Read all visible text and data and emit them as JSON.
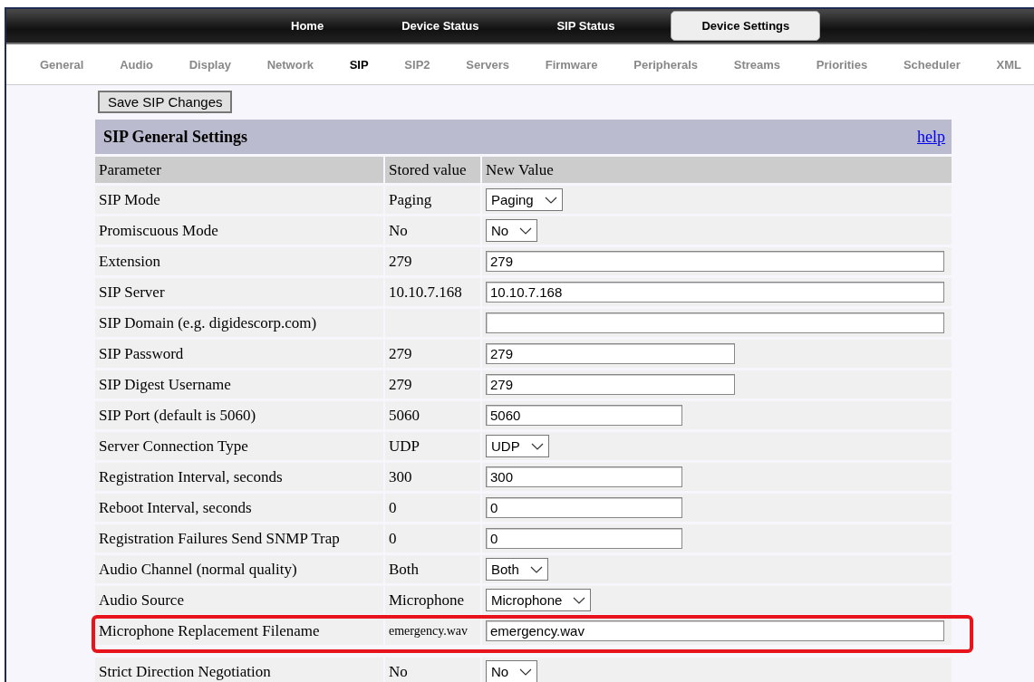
{
  "main_tabs": [
    {
      "label": "Home",
      "selected": false
    },
    {
      "label": "Device Status",
      "selected": false
    },
    {
      "label": "SIP Status",
      "selected": false
    },
    {
      "label": "Device Settings",
      "selected": true
    }
  ],
  "sub_tabs": [
    {
      "label": "General",
      "selected": false
    },
    {
      "label": "Audio",
      "selected": false
    },
    {
      "label": "Display",
      "selected": false
    },
    {
      "label": "Network",
      "selected": false
    },
    {
      "label": "SIP",
      "selected": true
    },
    {
      "label": "SIP2",
      "selected": false
    },
    {
      "label": "Servers",
      "selected": false
    },
    {
      "label": "Firmware",
      "selected": false
    },
    {
      "label": "Peripherals",
      "selected": false
    },
    {
      "label": "Streams",
      "selected": false
    },
    {
      "label": "Priorities",
      "selected": false
    },
    {
      "label": "Scheduler",
      "selected": false
    },
    {
      "label": "XML",
      "selected": false
    }
  ],
  "save_button": "Save SIP Changes",
  "section": {
    "title": "SIP General Settings",
    "help_link": "help"
  },
  "columns": [
    "Parameter",
    "Stored value",
    "New Value"
  ],
  "rows": [
    {
      "parameter": "SIP Mode",
      "stored": "Paging",
      "new_value": "Paging",
      "kind": "select",
      "highlighted": false
    },
    {
      "parameter": "Promiscuous Mode",
      "stored": "No",
      "new_value": "No",
      "kind": "select",
      "highlighted": false
    },
    {
      "parameter": "Extension",
      "stored": "279",
      "new_value": "279",
      "kind": "input-wide",
      "highlighted": false
    },
    {
      "parameter": "SIP Server",
      "stored": "10.10.7.168",
      "new_value": "10.10.7.168",
      "kind": "input-wide",
      "highlighted": false
    },
    {
      "parameter": "SIP Domain (e.g. digidescorp.com)",
      "stored": "",
      "new_value": "",
      "kind": "input-wide",
      "highlighted": false
    },
    {
      "parameter": "SIP Password",
      "stored": "279",
      "new_value": "279",
      "kind": "input-medium",
      "highlighted": false
    },
    {
      "parameter": "SIP Digest Username",
      "stored": "279",
      "new_value": "279",
      "kind": "input-medium",
      "highlighted": false
    },
    {
      "parameter": "SIP Port (default is 5060)",
      "stored": "5060",
      "new_value": "5060",
      "kind": "input-short",
      "highlighted": false
    },
    {
      "parameter": "Server Connection Type",
      "stored": "UDP",
      "new_value": "UDP",
      "kind": "select",
      "highlighted": false
    },
    {
      "parameter": "Registration Interval, seconds",
      "stored": "300",
      "new_value": "300",
      "kind": "input-short",
      "highlighted": false
    },
    {
      "parameter": "Reboot Interval, seconds",
      "stored": "0",
      "new_value": "0",
      "kind": "input-short",
      "highlighted": false
    },
    {
      "parameter": "Registration Failures Send SNMP Trap",
      "stored": "0",
      "new_value": "0",
      "kind": "input-short",
      "highlighted": false
    },
    {
      "parameter": "Audio Channel (normal quality)",
      "stored": "Both",
      "new_value": "Both",
      "kind": "select",
      "highlighted": false
    },
    {
      "parameter": "Audio Source",
      "stored": "Microphone",
      "new_value": "Microphone",
      "kind": "select",
      "highlighted": false
    },
    {
      "parameter": "Microphone Replacement Filename",
      "stored": "emergency.wav",
      "new_value": "emergency.wav",
      "kind": "input-wide",
      "highlighted": true
    },
    {
      "parameter": "Strict Direction Negotiation",
      "stored": "No",
      "new_value": "No",
      "kind": "select",
      "highlighted": false
    }
  ]
}
